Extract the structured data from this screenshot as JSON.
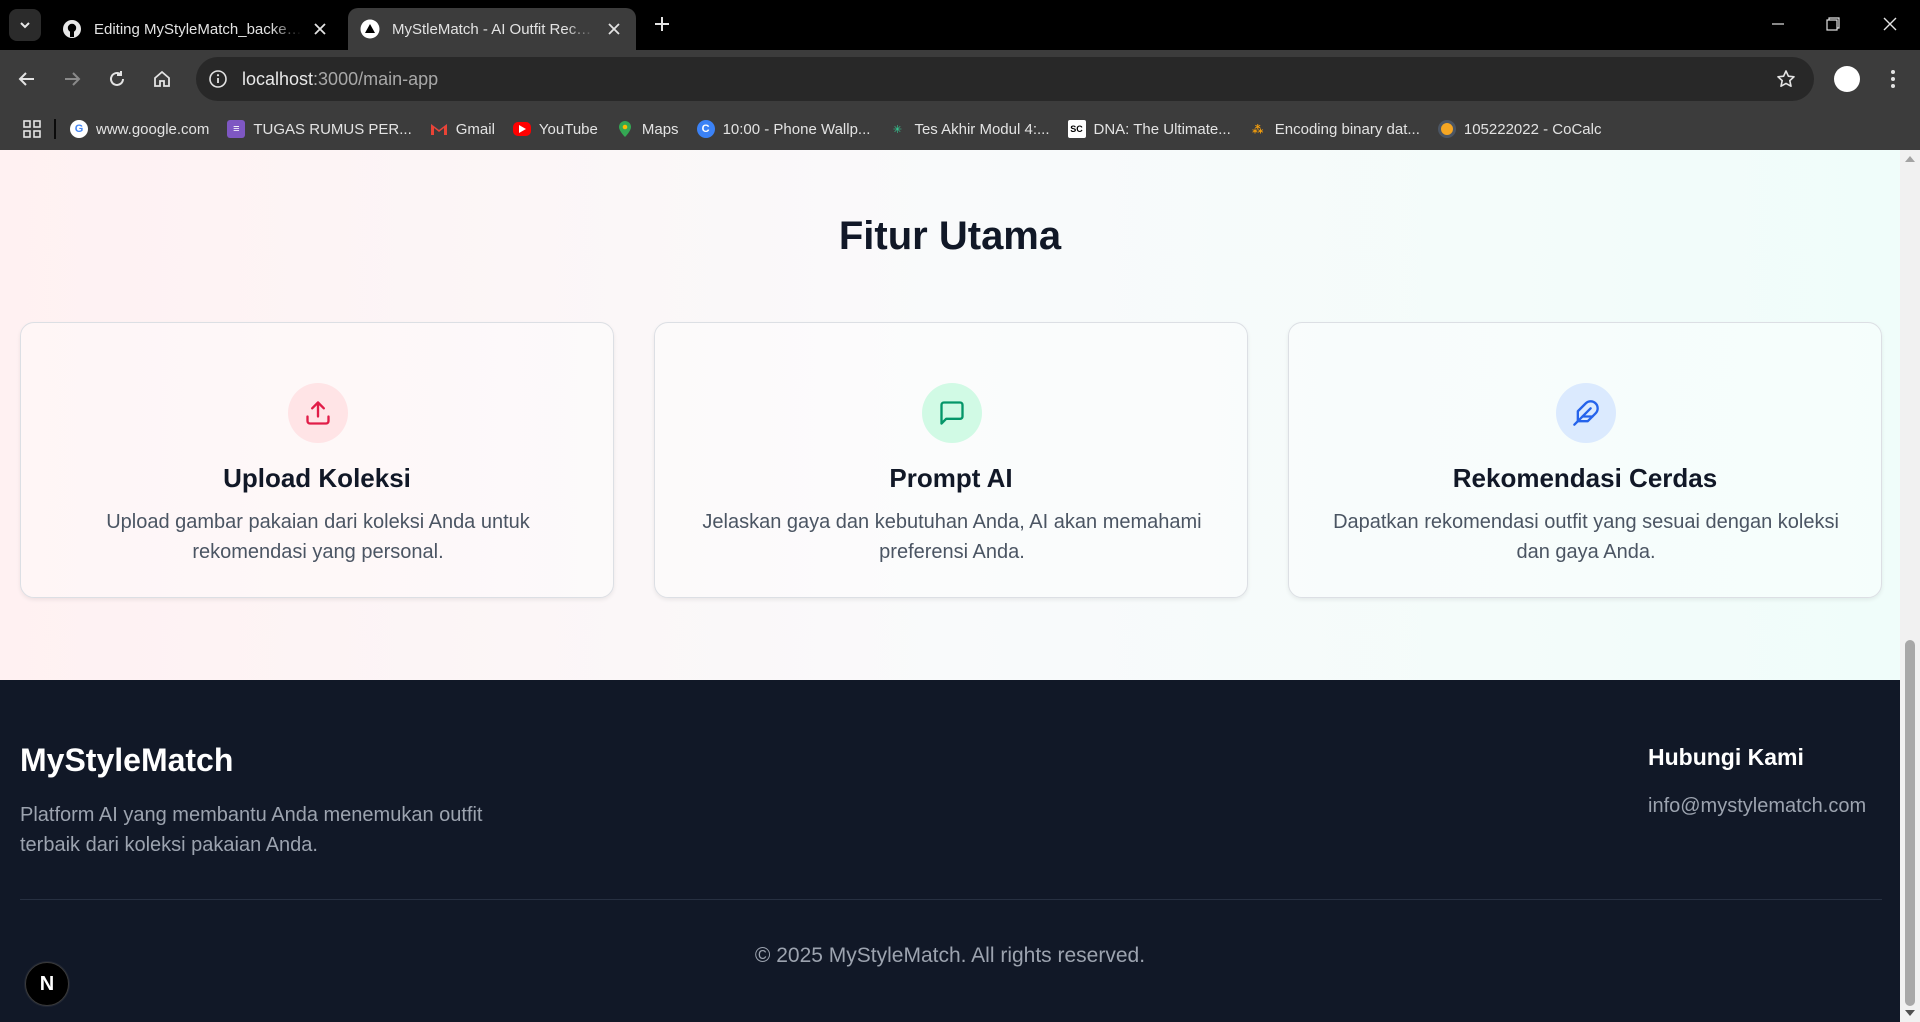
{
  "browser": {
    "tabs": [
      {
        "title": "Editing MyStyleMatch_backend_...",
        "favicon": "github-icon",
        "active": false
      },
      {
        "title": "MyStleMatch - AI Outfit Recomm...",
        "favicon": "nextjs-triangle-icon",
        "active": true
      }
    ],
    "address": {
      "host": "localhost",
      "path": ":3000/main-app"
    },
    "bookmarks": [
      {
        "label": "www.google.com",
        "icon": "google-icon"
      },
      {
        "label": "TUGAS RUMUS PER...",
        "icon": "sheets-icon"
      },
      {
        "label": "Gmail",
        "icon": "gmail-icon"
      },
      {
        "label": "YouTube",
        "icon": "youtube-icon"
      },
      {
        "label": "Maps",
        "icon": "maps-pin-icon"
      },
      {
        "label": "10:00 - Phone Wallp...",
        "icon": "wallpaper-icon"
      },
      {
        "label": "Tes Akhir Modul 4:...",
        "icon": "quiz-icon"
      },
      {
        "label": "DNA: The Ultimate...",
        "icon": "dna-icon"
      },
      {
        "label": "Encoding binary dat...",
        "icon": "encoding-icon"
      },
      {
        "label": "105222022 - CoCalc",
        "icon": "cocalc-icon"
      }
    ]
  },
  "features": {
    "title": "Fitur Utama",
    "cards": [
      {
        "title": "Upload Koleksi",
        "description": "Upload gambar pakaian dari koleksi Anda untuk rekomendasi yang personal.",
        "icon": "upload-icon",
        "icon_color": "#e11d48",
        "icon_bg": "#ffe4e6"
      },
      {
        "title": "Prompt AI",
        "description": "Jelaskan gaya dan kebutuhan Anda, AI akan memahami preferensi Anda.",
        "icon": "chat-bubble-icon",
        "icon_color": "#059669",
        "icon_bg": "#d1fae5"
      },
      {
        "title": "Rekomendasi Cerdas",
        "description": "Dapatkan rekomendasi outfit yang sesuai dengan koleksi dan gaya Anda.",
        "icon": "feather-icon",
        "icon_color": "#2563eb",
        "icon_bg": "#dbeafe"
      }
    ]
  },
  "footer": {
    "brand": "MyStyleMatch",
    "description": "Platform AI yang membantu Anda menemukan outfit terbaik dari koleksi pakaian Anda.",
    "contact_title": "Hubungi Kami",
    "email": "info@mystylematch.com",
    "copyright": "© 2025 MyStyleMatch. All rights reserved."
  },
  "dev_badge": {
    "letter": "N",
    "icon": "nextjs-dev-icon"
  },
  "colors": {
    "footer_bg": "#111827",
    "footer_text": "#9ca3af",
    "heading": "#111827"
  }
}
